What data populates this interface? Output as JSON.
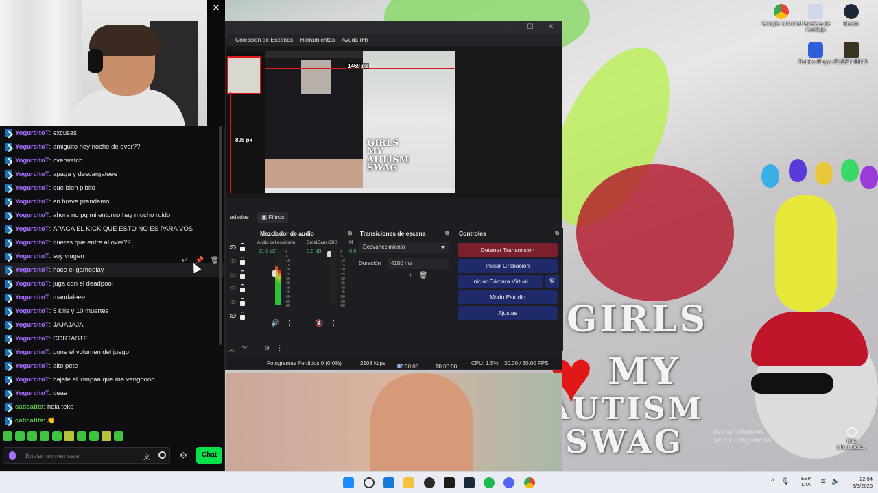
{
  "desktop": {
    "icons": [
      {
        "label": "Google Chrome"
      },
      {
        "label": "Papelera de reciclaje"
      },
      {
        "label": "Steam"
      },
      {
        "label": "Roblox Player"
      },
      {
        "label": "ELDEN RING"
      }
    ],
    "meme_lines": [
      "GIRLS",
      "MY",
      "AUTISM",
      "SWAG"
    ],
    "watermark": {
      "line1": "Activar Windows",
      "line2": "Ve a Configuración"
    },
    "more_info_label": "Más informació..."
  },
  "webcam": {
    "close_glyph": "✕"
  },
  "chat": {
    "messages": [
      {
        "user": "YogurcitoT",
        "text": "excusas"
      },
      {
        "user": "YogurcitoT",
        "text": "amiguito hoy noche de over??"
      },
      {
        "user": "YogurcitoT",
        "text": "overwatch"
      },
      {
        "user": "YogurcitoT",
        "text": "apaga y descargateee"
      },
      {
        "user": "YogurcitoT",
        "text": "que bien pibito"
      },
      {
        "user": "YogurcitoT",
        "text": "en breve prendemo"
      },
      {
        "user": "YogurcitoT",
        "text": "ahora no pq mi entorno hay mucho ruido"
      },
      {
        "user": "YogurcitoT",
        "text": "APAGA EL KICK QUE ESTO NO ES PARA VOS"
      },
      {
        "user": "YogurcitoT",
        "text": "queres que entre al over??"
      },
      {
        "user": "YogurcitoT",
        "text": "soy viugerr"
      },
      {
        "user": "YogurcitoT",
        "text": "hace el gameplay"
      },
      {
        "user": "YogurcitoT",
        "text": "juga con el deadpool"
      },
      {
        "user": "YogurcitoT",
        "text": "mandaleee"
      },
      {
        "user": "YogurcitoT",
        "text": "5 kills y 10 muertes"
      },
      {
        "user": "YogurcitoT",
        "text": "JAJAJAJA"
      },
      {
        "user": "YogurcitoT",
        "text": "CORTASTE"
      },
      {
        "user": "YogurcitoT",
        "text": "pone el volumen del juego"
      },
      {
        "user": "YogurcitoT",
        "text": "alto pete"
      },
      {
        "user": "YogurcitoT",
        "text": "bajate el lompaa que me vengoooo"
      },
      {
        "user": "YogurcitoT",
        "text": "deaa"
      },
      {
        "user": "caticatita",
        "text": "hola teko"
      },
      {
        "user": "caticatita",
        "text": "👏"
      }
    ],
    "input_placeholder": "Enviar un mensaje",
    "send_label": "Chat"
  },
  "obs": {
    "menu": [
      "Colección de Escenas",
      "Herramientas",
      "Ayuda (H)"
    ],
    "preview": {
      "width_label": "1469 px",
      "height_label": "806 px"
    },
    "tabs": {
      "properties": "edades",
      "filters": "Filtros"
    },
    "mixer": {
      "title": "Mezclador de audio",
      "channels": [
        {
          "name": "Audio del escritorio",
          "db": "-11.8 dB"
        },
        {
          "name": "DroidCam OBS",
          "db": "0.0 dB"
        },
        {
          "name": "M",
          "db": "0.0"
        }
      ],
      "scale": [
        "0",
        "-5",
        "-10",
        "-15",
        "-20",
        "-25",
        "-30",
        "-35",
        "-40",
        "-45",
        "-50",
        "-55",
        "-60"
      ]
    },
    "transitions": {
      "title": "Transiciones de escena",
      "selected": "Desvanecimiento",
      "duration_label": "Duración",
      "duration_value": "4150 ms"
    },
    "controls": {
      "title": "Controles",
      "stop_stream": "Detener Transmisión",
      "start_record": "Iniciar Grabación",
      "start_vcam": "Iniciar Cámara Virtual",
      "studio_mode": "Modo Estudio",
      "settings": "Ajustes"
    },
    "status": {
      "dropped": "Fotogramas Perdidos 0 (0.0%)",
      "bitrate": "2108 kbps",
      "stream_time": "00:30:08",
      "rec_time": "00:00:00",
      "cpu": "CPU: 1.5%",
      "fps": "30.00 / 30.00 FPS"
    }
  },
  "taskbar": {
    "lang_line1": "ESP",
    "lang_line2": "LAA",
    "time": "22:04",
    "date": "3/3/2026"
  }
}
